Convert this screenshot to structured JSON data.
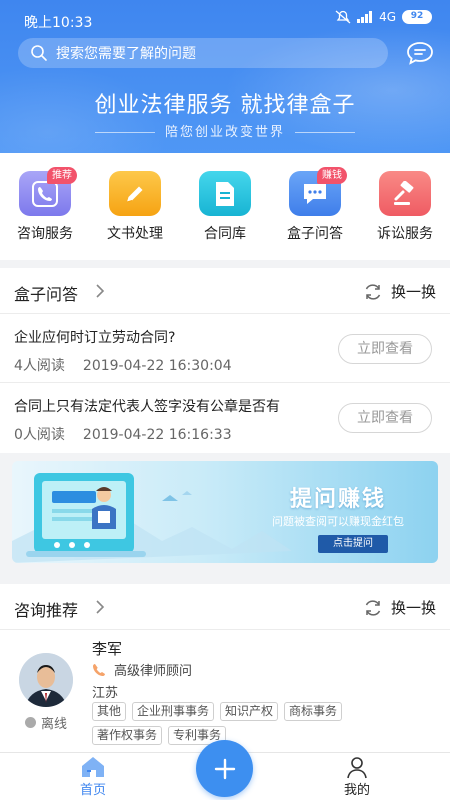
{
  "status_bar": {
    "time": "晚上10:33",
    "network": "4G",
    "battery": "92"
  },
  "search": {
    "placeholder": "搜索您需要了解的问题"
  },
  "hero": {
    "slogan": "创业法律服务  就找律盒子",
    "subtitle": "陪您创业改变世界"
  },
  "services": [
    {
      "label": "咨询服务",
      "tag": "推荐",
      "icon": "phone-icon",
      "color": "#8f8cf2"
    },
    {
      "label": "文书处理",
      "tag": "",
      "icon": "pencil-icon",
      "color": "#f9b523"
    },
    {
      "label": "合同库",
      "tag": "",
      "icon": "document-icon",
      "color": "#28c6e0"
    },
    {
      "label": "盒子问答",
      "tag": "赚钱",
      "icon": "chat-icon",
      "color": "#4c8df2"
    },
    {
      "label": "诉讼服务",
      "tag": "",
      "icon": "gavel-icon",
      "color": "#f2686b"
    }
  ],
  "qa_section": {
    "title": "盒子问答",
    "refresh_label": "换一换",
    "items": [
      {
        "question": "企业应何时订立劳动合同?",
        "reads": "4人阅读",
        "date": "2019-04-22 16:30:04",
        "button": "立即查看"
      },
      {
        "question": "合同上只有法定代表人签字没有公章是否有",
        "reads": "0人阅读",
        "date": "2019-04-22 16:16:33",
        "button": "立即查看"
      }
    ]
  },
  "banner": {
    "title": "提问赚钱",
    "subtitle": "问题被查阅可以赚现金红包",
    "button": "点击提问"
  },
  "consult_section": {
    "title": "咨询推荐",
    "refresh_label": "换一换",
    "lawyer": {
      "name": "李军",
      "title": "高级律师顾问",
      "location": "江苏",
      "status": "离线",
      "tags": [
        "其他",
        "企业刑事事务",
        "知识产权",
        "商标事务",
        "著作权事务",
        "专利事务"
      ]
    }
  },
  "tabbar": {
    "home": "首页",
    "mine": "我的"
  },
  "colors": {
    "primary": "#3f86ef",
    "tag_red": "#f2536b"
  }
}
